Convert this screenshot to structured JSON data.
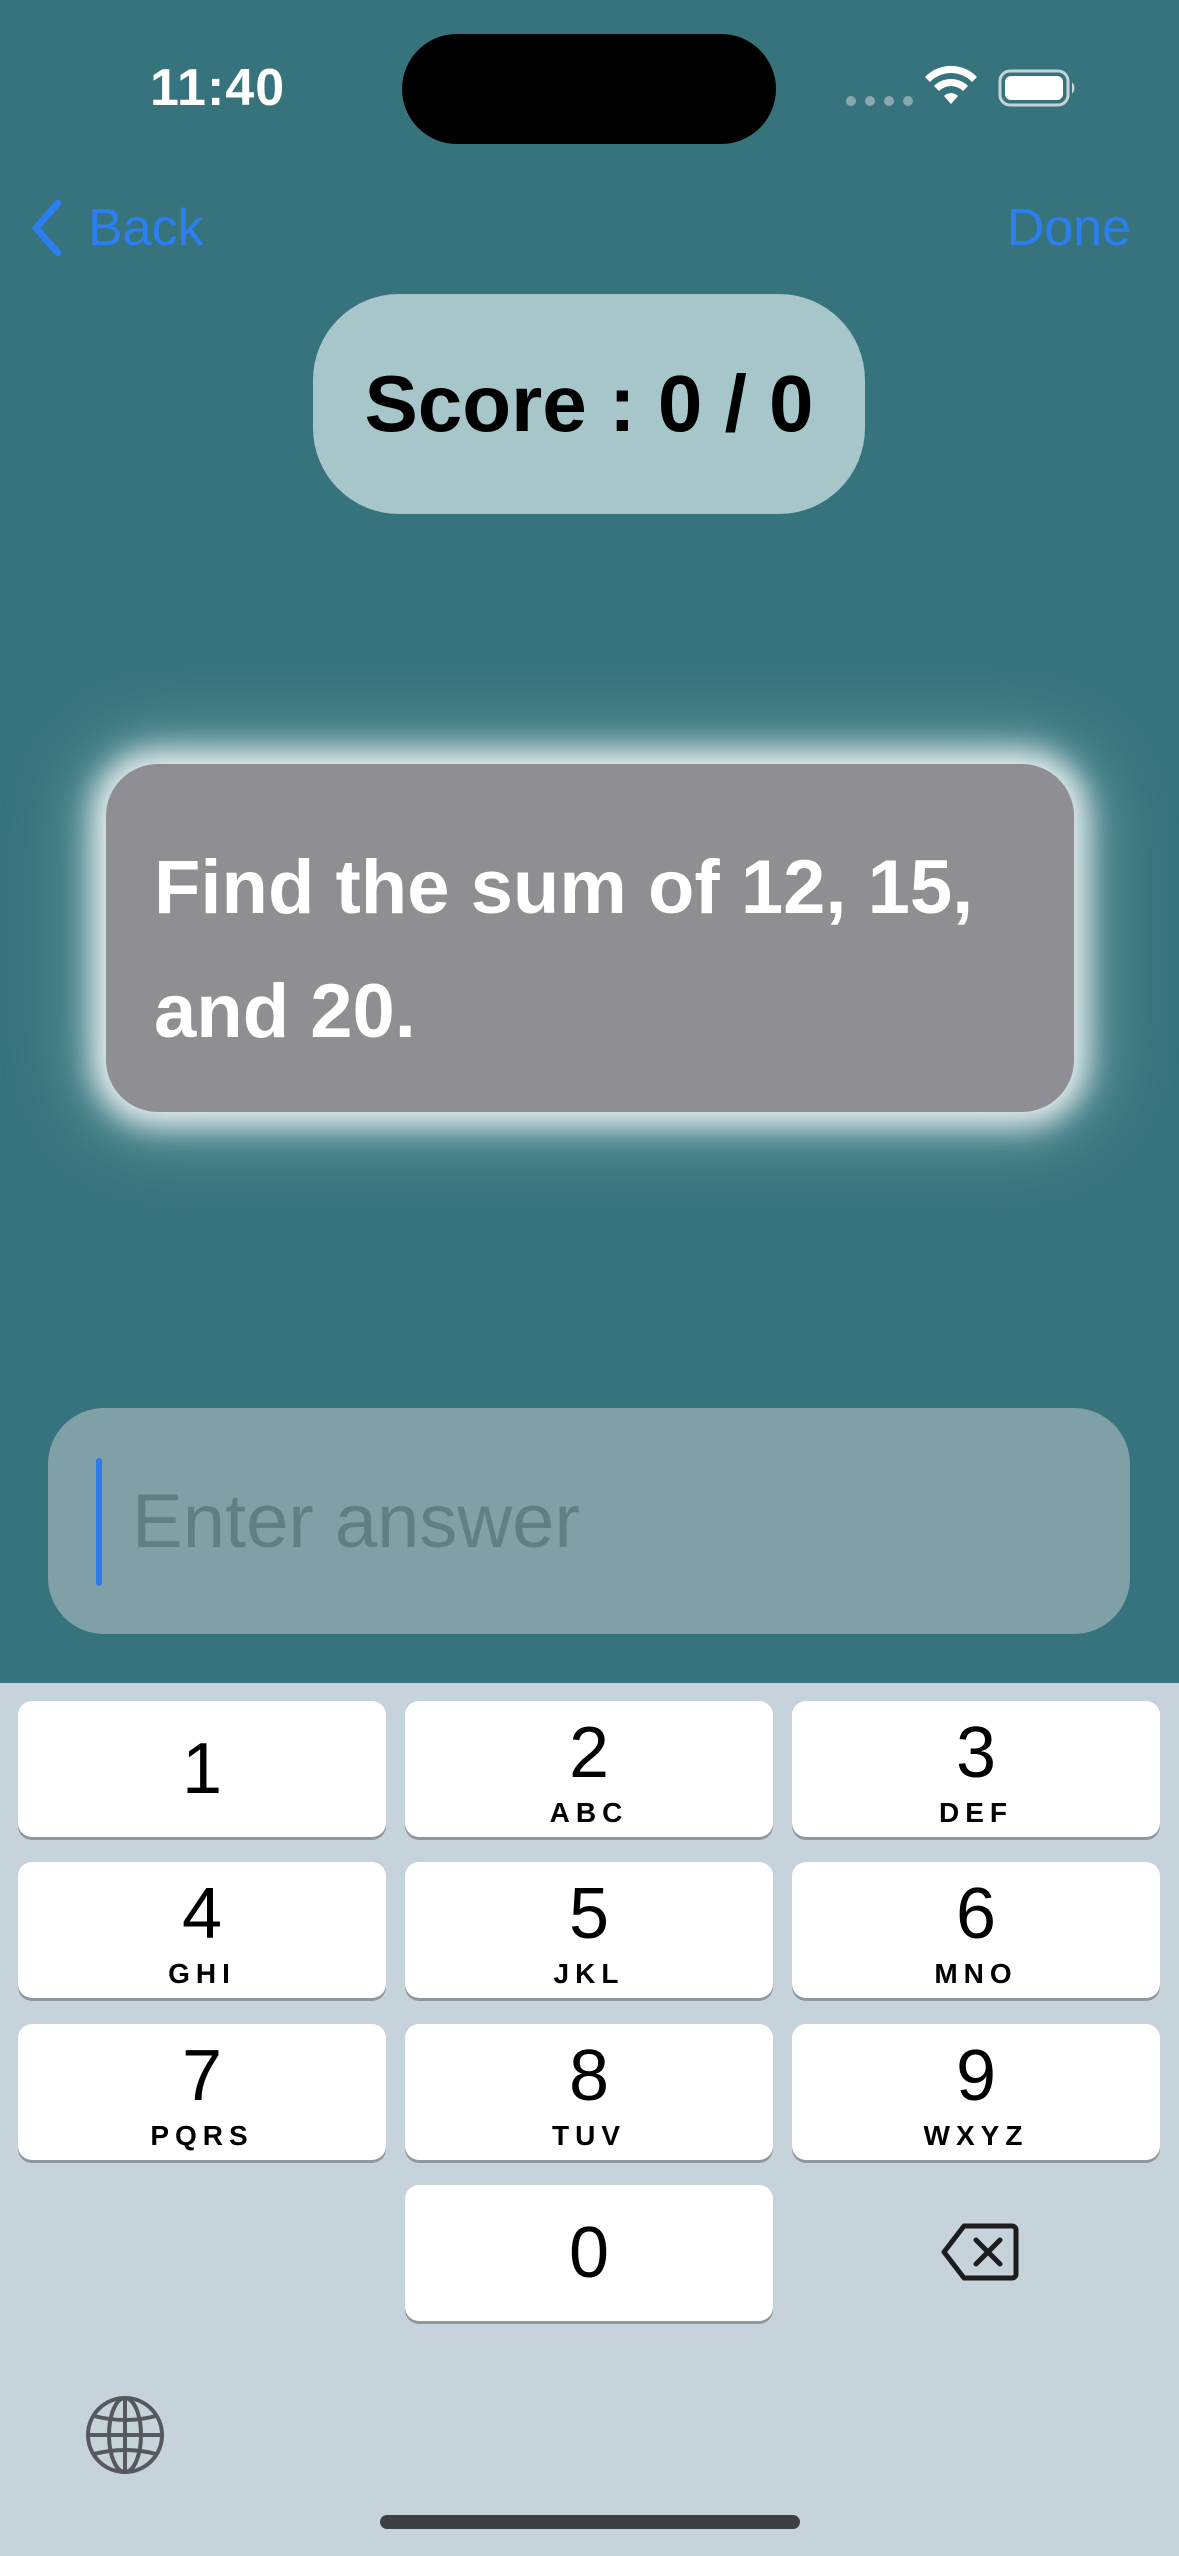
{
  "status_bar": {
    "time": "11:40"
  },
  "nav": {
    "back_label": "Back",
    "done_label": "Done"
  },
  "score": {
    "text": "Score : 0 / 0"
  },
  "question": {
    "line1": "Find the sum of 12, 15,",
    "line2": "and 20."
  },
  "answer": {
    "placeholder": "Enter answer",
    "value": ""
  },
  "keyboard": {
    "keys": [
      {
        "digit": "1",
        "letters": ""
      },
      {
        "digit": "2",
        "letters": "ABC"
      },
      {
        "digit": "3",
        "letters": "DEF"
      },
      {
        "digit": "4",
        "letters": "GHI"
      },
      {
        "digit": "5",
        "letters": "JKL"
      },
      {
        "digit": "6",
        "letters": "MNO"
      },
      {
        "digit": "7",
        "letters": "PQRS"
      },
      {
        "digit": "8",
        "letters": "TUV"
      },
      {
        "digit": "9",
        "letters": "WXYZ"
      },
      {
        "digit": "0",
        "letters": ""
      }
    ],
    "delete_icon": "delete-icon",
    "globe_icon": "globe-icon"
  },
  "colors": {
    "background": "#37737c",
    "accent": "#2b7ff0",
    "score_pill": "#a6c6ca",
    "question_card": "#8f8e93",
    "keyboard_bg": "#c6d3da"
  }
}
